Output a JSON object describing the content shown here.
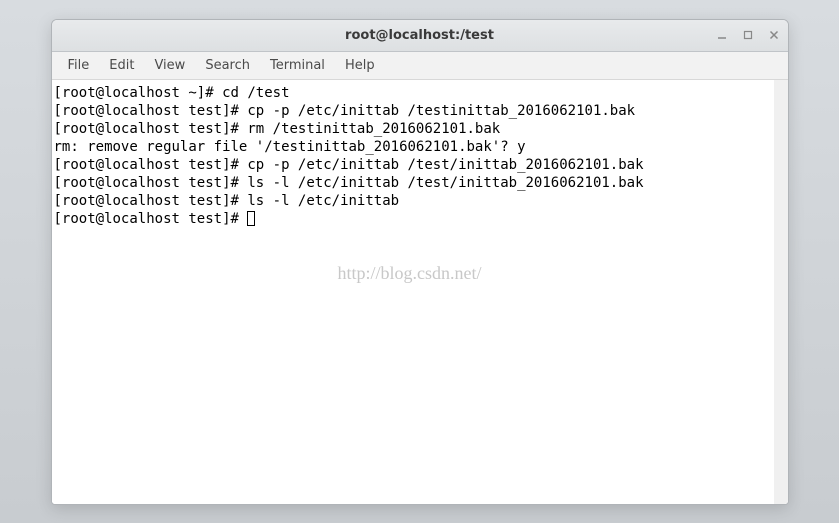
{
  "window": {
    "title": "root@localhost:/test"
  },
  "menubar": {
    "items": [
      "File",
      "Edit",
      "View",
      "Search",
      "Terminal",
      "Help"
    ]
  },
  "terminal": {
    "lines": [
      "[root@localhost ~]# cd /test",
      "[root@localhost test]# cp -p /etc/inittab /testinittab_2016062101.bak",
      "[root@localhost test]# rm /testinittab_2016062101.bak",
      "rm: remove regular file '/testinittab_2016062101.bak'? y",
      "[root@localhost test]# cp -p /etc/inittab /test/inittab_2016062101.bak",
      "[root@localhost test]# ls -l /etc/inittab /test/inittab_2016062101.bak",
      "[root@localhost test]# ls -l /etc/inittab",
      "[root@localhost test]# "
    ]
  },
  "watermark": "http://blog.csdn.net/"
}
